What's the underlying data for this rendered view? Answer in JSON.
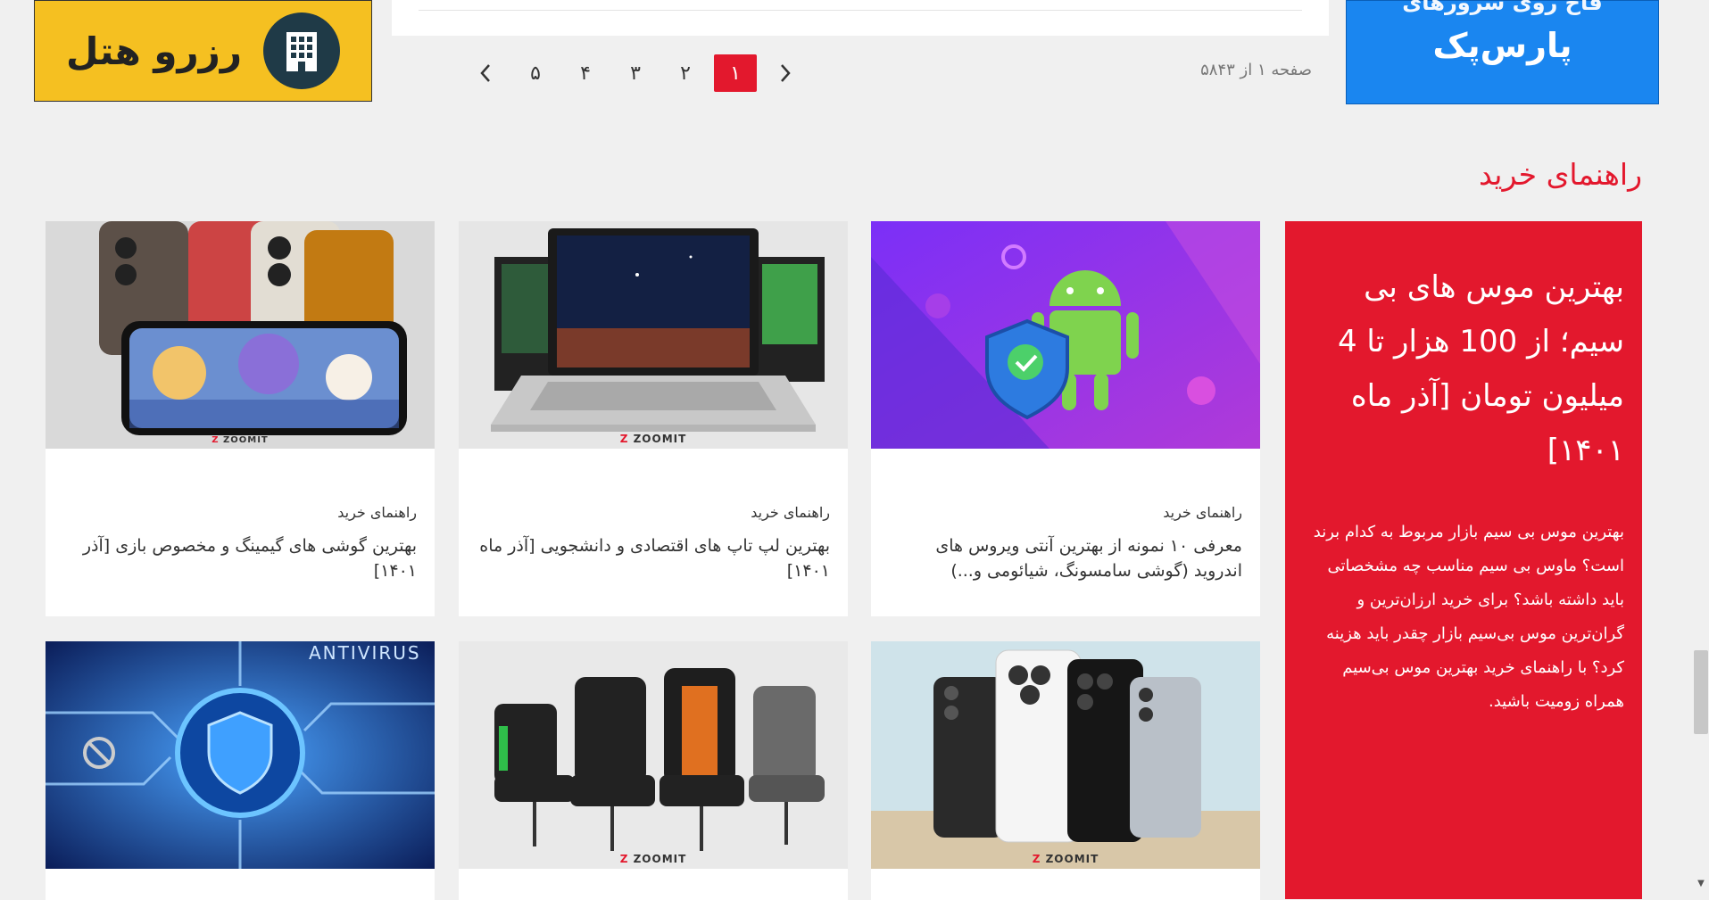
{
  "banners": {
    "hotel": {
      "text": "رزرو هتل",
      "icon": "building-icon",
      "color": "#f5c021"
    },
    "parspack": {
      "line1": "فاح روی سرورهای",
      "line2": "پارس‌پک",
      "color": "#1a86f0"
    }
  },
  "pagination": {
    "info": "صفحه ۱ از ۵۸۴۳",
    "pages": [
      "۱",
      "۲",
      "۳",
      "۴",
      "۵"
    ],
    "active": "۱",
    "prev_icon": "chevron-right-icon",
    "next_icon": "chevron-left-icon"
  },
  "section": {
    "title": "راهنمای خرید",
    "accent": "#e3182d"
  },
  "featured": {
    "title": "بهترین موس های بی سیم؛ از 100 هزار تا 4 میلیون تومان [آذر ماه ۱۴۰۱]",
    "description": "بهترین موس بی سیم بازار مربوط به کدام برند است؟ ماوس بی سیم مناسب چه مشخصاتی باید داشته باشد؟ برای خرید ارزان‌ترین و گران‌ترین موس بی‌سیم بازار چقدر باید هزینه کرد؟ با راهنمای خرید بهترین موس بی‌سیم همراه زومیت باشید."
  },
  "cards": [
    {
      "category": "راهنمای خرید",
      "title": "معرفی ۱۰ نمونه از بهترین آنتی ویروس های اندروید (گوشی سامسونگ، شیائومی و...)",
      "image": "android-antivirus"
    },
    {
      "category": "راهنمای خرید",
      "title": "بهترین لپ تاپ های اقتصادی و دانشجویی [آذر ماه ۱۴۰۱]",
      "image": "laptop"
    },
    {
      "category": "راهنمای خرید",
      "title": "بهترین گوشی های گیمینگ و مخصوص بازی [آذر ۱۴۰۱]",
      "image": "gaming-phone"
    },
    {
      "category": "",
      "title": "",
      "image": "flagship-phones"
    },
    {
      "category": "",
      "title": "",
      "image": "gaming-chairs"
    },
    {
      "category": "",
      "title": "",
      "image": "antivirus-shield"
    }
  ],
  "watermark": {
    "z": "Z",
    "text": "ZOOMIT"
  },
  "antivirus_art_text": "ANTIVIRUS"
}
